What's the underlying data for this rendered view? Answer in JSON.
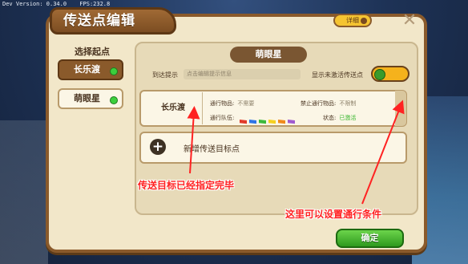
{
  "debug": {
    "version": "Dev Version: 0.34.0",
    "fps": "FPS:232.8"
  },
  "dialog": {
    "title": "传送点编辑",
    "detail_label": "详细",
    "close_icon": "close-icon",
    "confirm_label": "确定"
  },
  "start_points": {
    "header": "选择起点",
    "items": [
      {
        "label": "长乐渡",
        "selected": true,
        "status_color": "#3ccf3c"
      },
      {
        "label": "萌眼星",
        "selected": false,
        "status_color": "#3ccf3c"
      }
    ]
  },
  "target": {
    "planet_name": "萌眼星",
    "arrive_hint_label": "到达提示",
    "arrive_hint_placeholder": "点击编辑提示信息",
    "show_inactive_label": "显示未激活传送点",
    "show_inactive_toggle": "on",
    "card": {
      "name": "长乐渡",
      "pass_item_label": "通行物品:",
      "pass_item_value": "不需要",
      "forbid_item_label": "禁止通行物品:",
      "forbid_item_value": "不限制",
      "team_label": "通行队伍:",
      "team_flags": [
        "#e23a2a",
        "#2f74e8",
        "#3cba3c",
        "#f5d020",
        "#f08a1c",
        "#a05ad0"
      ],
      "status_label": "状态:",
      "status_value": "已激活",
      "edit_icon": "pencil-icon"
    },
    "add_label": "新增传送目标点",
    "add_icon": "plus-icon"
  },
  "annotations": {
    "target_done": "传送目标已经指定完毕",
    "set_conditions": "这里可以设置通行条件"
  },
  "colors": {
    "accent": "#8a5a2b",
    "confirm": "#2e9a1e",
    "annotation": "#ff2222"
  }
}
